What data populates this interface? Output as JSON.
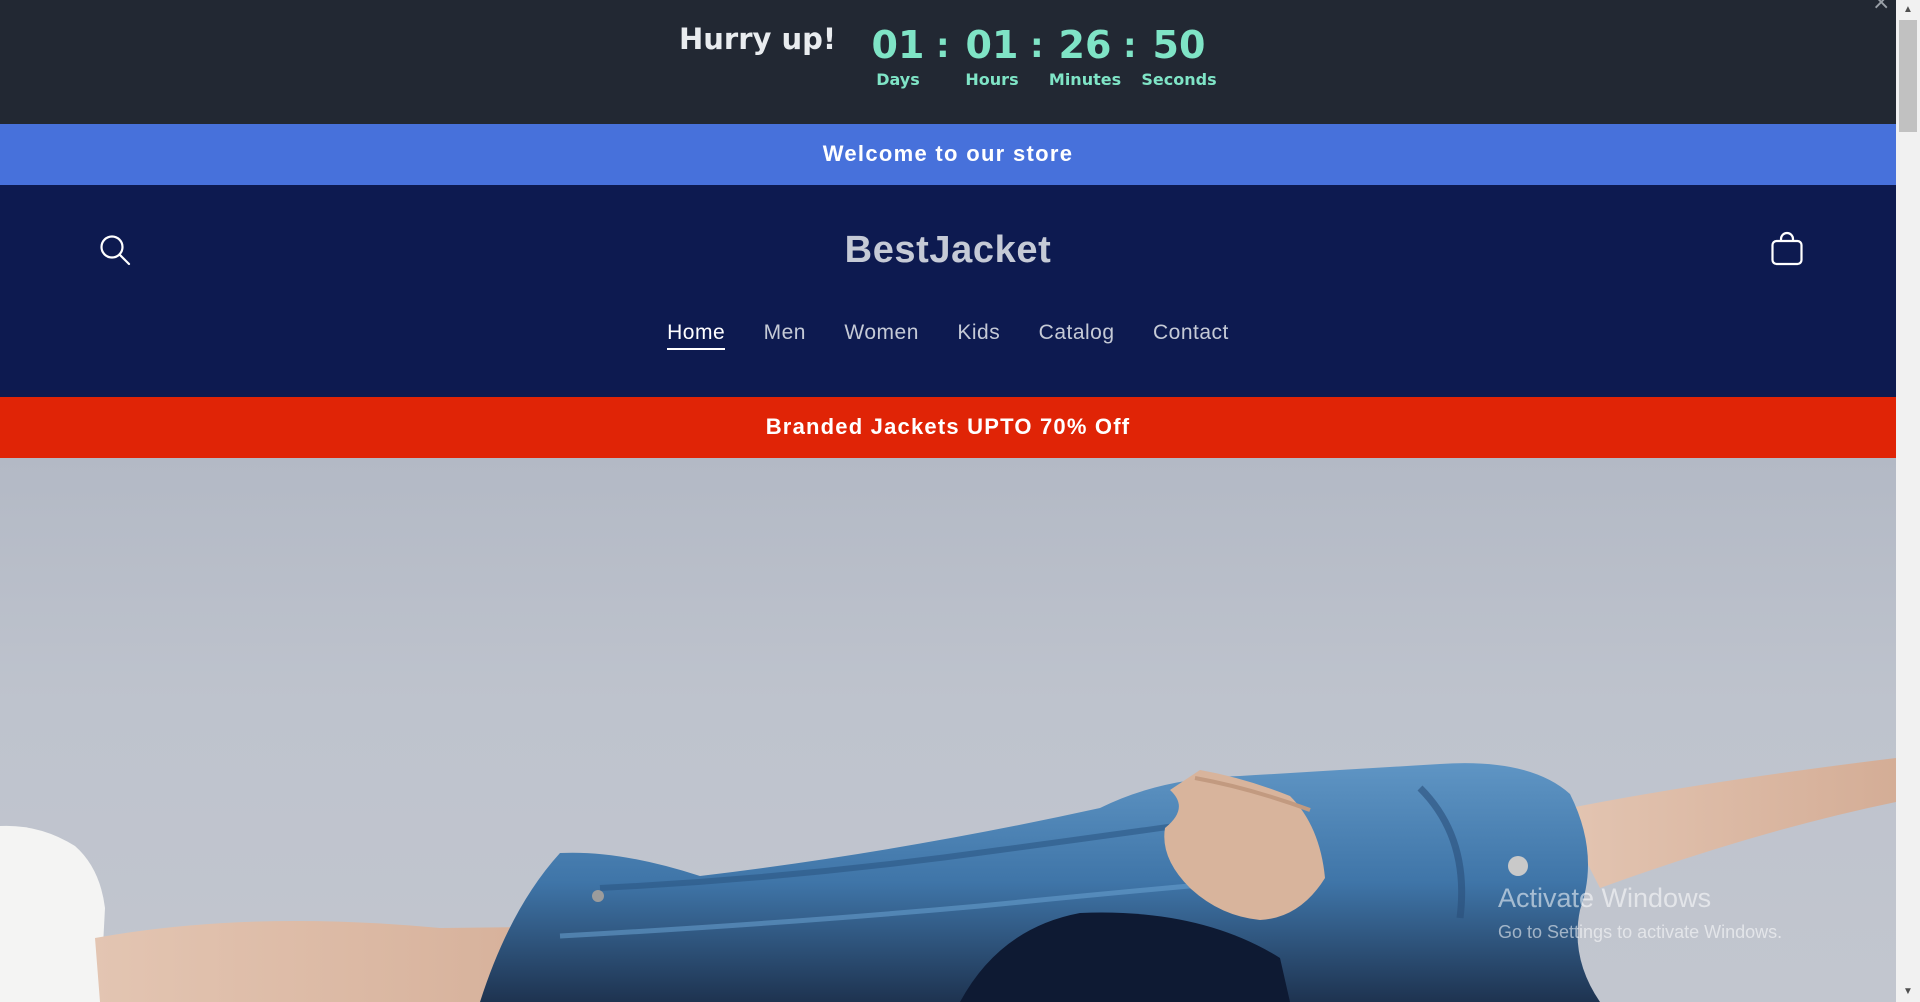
{
  "countdown": {
    "headline": "Hurry up!",
    "units": [
      {
        "value": "01",
        "label": "Days"
      },
      {
        "value": "01",
        "label": "Hours"
      },
      {
        "value": "26",
        "label": "Minutes"
      },
      {
        "value": "50",
        "label": "Seconds"
      }
    ],
    "separator": ":",
    "close_icon": "close-icon",
    "close_glyph": "×",
    "colors": {
      "background": "#222833",
      "digits": "#7fe4c6"
    }
  },
  "announcement": {
    "text": "Welcome to our store",
    "color": "#4771db"
  },
  "header": {
    "logo": "BestJacket",
    "search_icon": "search-icon",
    "cart_icon": "cart-icon",
    "background": "#0d1a50",
    "nav": [
      {
        "label": "Home",
        "active": true
      },
      {
        "label": "Men",
        "active": false
      },
      {
        "label": "Women",
        "active": false
      },
      {
        "label": "Kids",
        "active": false
      },
      {
        "label": "Catalog",
        "active": false
      },
      {
        "label": "Contact",
        "active": false
      }
    ]
  },
  "promo": {
    "text": "Branded Jackets UPTO 70% Off",
    "color": "#e02406"
  },
  "hero": {
    "image": "denim-jacket-hands-photo"
  },
  "os_watermark": {
    "title": "Activate Windows",
    "subtitle": "Go to Settings to activate Windows."
  },
  "scrollbar": {
    "up_glyph": "▲",
    "down_glyph": "▼"
  }
}
